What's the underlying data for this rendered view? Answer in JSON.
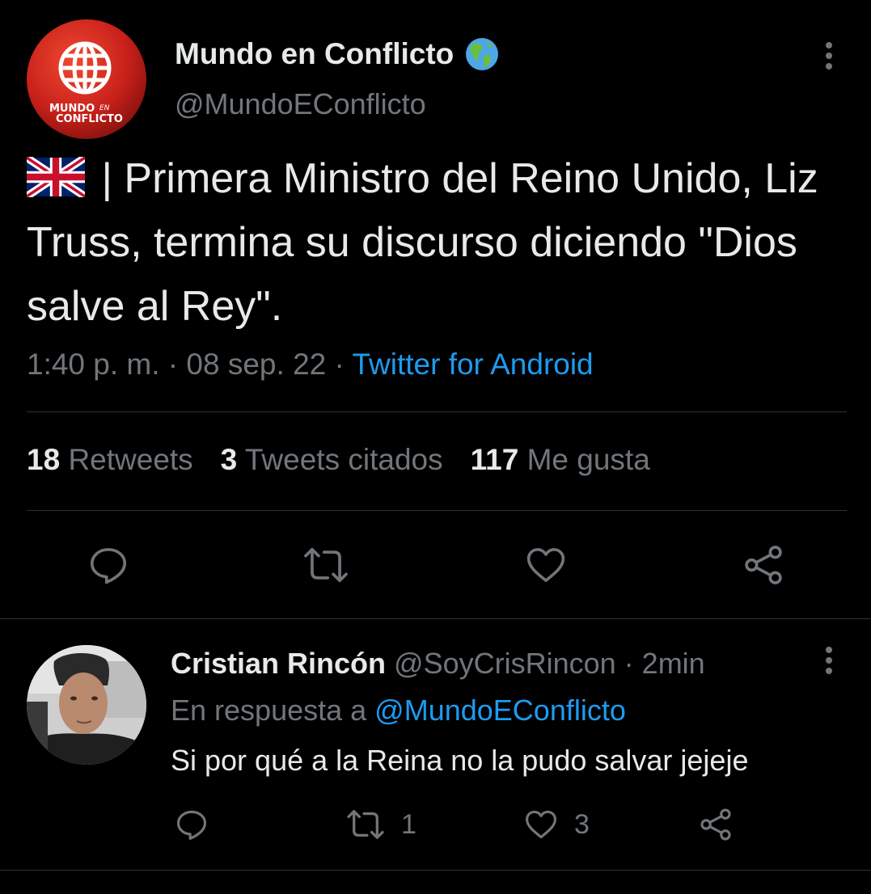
{
  "tweet": {
    "author_name": "Mundo en Conflicto",
    "author_handle": "@MundoEConflicto",
    "avatar_logo_text": [
      "MUNDO",
      "EN",
      "CONFLICTO"
    ],
    "verified_emoji": "globe-americas-icon",
    "flag_emoji": "uk-flag-icon",
    "text_after_flag": " | Primera Ministro del Reino Unido, Liz Truss, termina su discurso diciendo \"Dios salve al Rey\".",
    "time": "1:40 p. m.",
    "separator": " · ",
    "date": "08 sep. 22",
    "source": "Twitter for Android",
    "stats": {
      "retweets_count": "18",
      "retweets_label": "Retweets",
      "quotes_count": "3",
      "quotes_label": "Tweets citados",
      "likes_count": "117",
      "likes_label": "Me gusta"
    }
  },
  "reply": {
    "author_name": "Cristian Rincón",
    "author_handle": "@SoyCrisRincon",
    "time_sep": " · ",
    "time": "2min",
    "reply_prefix": "En respuesta a ",
    "reply_mention": "@MundoEConflicto",
    "text": "Si por qué a la Reina no la pudo salvar jejeje",
    "actions": {
      "retweets": "1",
      "likes": "3"
    }
  },
  "colors": {
    "background": "#000000",
    "text": "#e7e9ea",
    "muted": "#71767b",
    "accent": "#1d9bf0",
    "divider": "#2f3336",
    "logo_red": "#d12a1f"
  }
}
